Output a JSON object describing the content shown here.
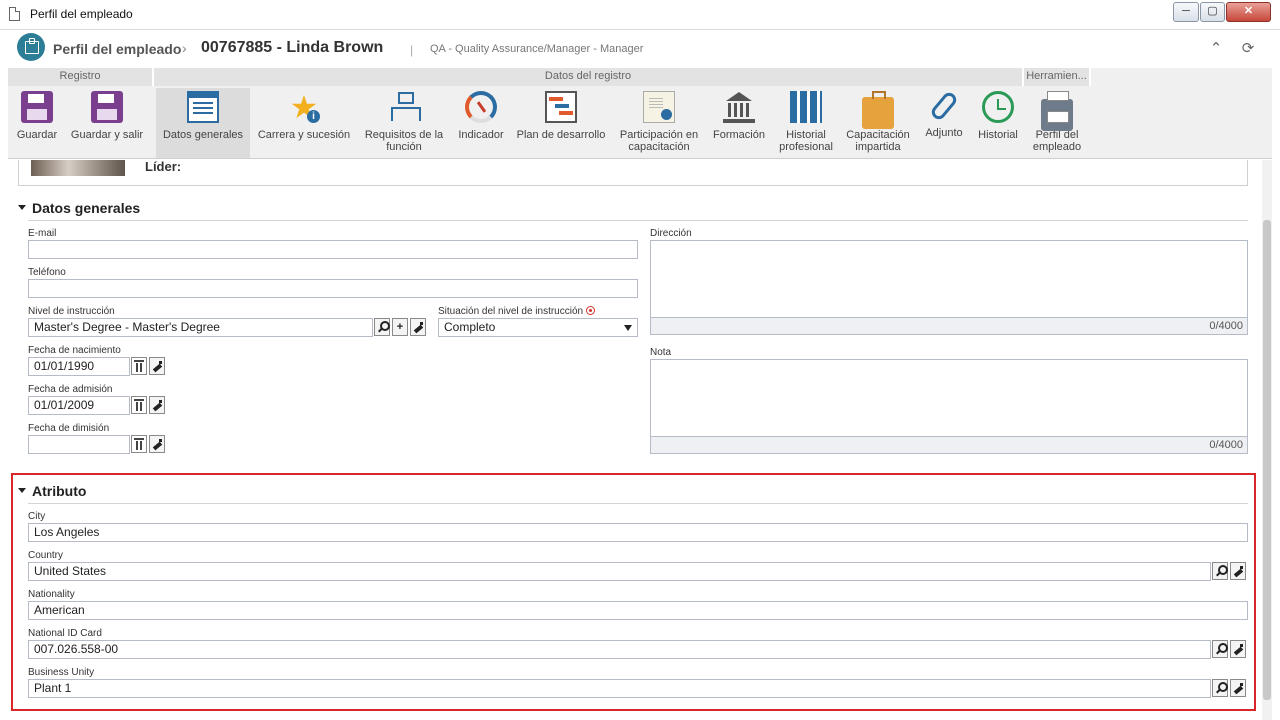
{
  "window": {
    "title": "Perfil del empleado",
    "minimize": "─",
    "maximize": "▢",
    "close": "✕"
  },
  "header": {
    "module": "Perfil del empleado",
    "separator": "›",
    "record": "00767885 - Linda Brown",
    "pipe": "|",
    "role": "QA - Quality Assurance/Manager - Manager",
    "collapse_glyph": "⌃",
    "refresh_glyph": "⟳"
  },
  "ribbon": {
    "groups": {
      "registro": "Registro",
      "datos": "Datos del registro",
      "herramientas": "Herramien..."
    },
    "buttons": {
      "guardar": "Guardar",
      "guardar_salir": "Guardar y salir",
      "datos_generales": "Datos generales",
      "carrera": "Carrera y sucesión",
      "requisitos": "Requisitos de la función",
      "indicador": "Indicador",
      "plan": "Plan de desarrollo",
      "participacion": "Participación en capacitación",
      "formacion": "Formación",
      "historial_prof": "Historial profesional",
      "capacitacion": "Capacitación impartida",
      "adjunto": "Adjunto",
      "historial": "Historial",
      "perfil": "Perfil del empleado"
    },
    "info_glyph": "i"
  },
  "profile": {
    "lider_label": "Líder:"
  },
  "datos_generales": {
    "title": "Datos generales",
    "email_label": "E-mail",
    "email_value": "",
    "telefono_label": "Teléfono",
    "telefono_value": "",
    "nivel_label": "Nivel de instrucción",
    "nivel_value": "Master's Degree - Master's Degree",
    "situacion_label": "Situación del nivel de instrucción",
    "situacion_value": "Completo",
    "nacimiento_label": "Fecha de nacimiento",
    "nacimiento_value": "01/01/1990",
    "admision_label": "Fecha de admisión",
    "admision_value": "01/01/2009",
    "dimision_label": "Fecha de dimisión",
    "dimision_value": "",
    "direccion_label": "Dirección",
    "direccion_counter": "0/4000",
    "nota_label": "Nota",
    "nota_counter": "0/4000",
    "add_glyph": "+"
  },
  "atributo": {
    "title": "Atributo",
    "city_label": "City",
    "city_value": "Los Angeles",
    "country_label": "Country",
    "country_value": "United States",
    "nationality_label": "Nationality",
    "nationality_value": "American",
    "national_id_label": "National ID Card",
    "national_id_value": "007.026.558-00",
    "business_label": "Business Unity",
    "business_value": "Plant 1"
  },
  "colors": {
    "accent": "#2c7d96",
    "highlight_border": "#d8262b",
    "ribbon_bg": "#f0f0f0"
  }
}
